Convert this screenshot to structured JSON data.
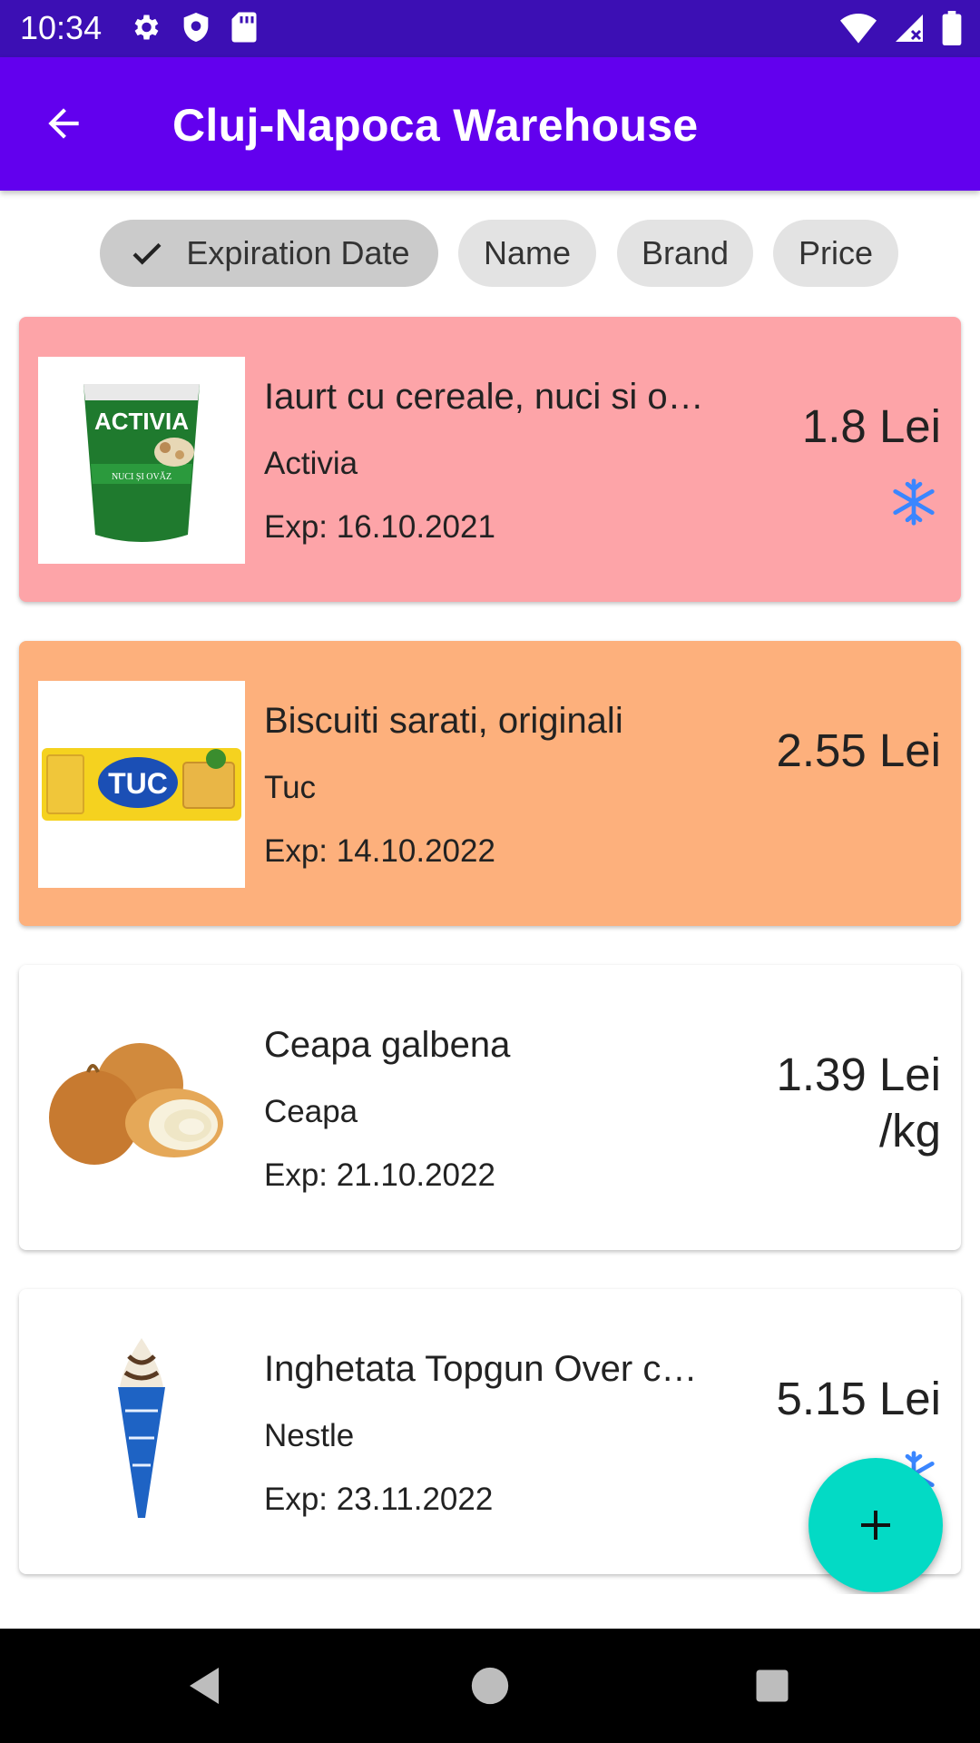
{
  "status_bar": {
    "time": "10:34",
    "left_icons": [
      "gear-icon",
      "shield-icon",
      "sd-card-icon"
    ],
    "right_icons": [
      "wifi-icon",
      "signal-icon",
      "battery-icon"
    ]
  },
  "app_bar": {
    "title": "Cluj-Napoca Warehouse",
    "back_icon": "arrow-back-icon"
  },
  "filters": {
    "chips": [
      {
        "label": "Expiration Date",
        "selected": true
      },
      {
        "label": "Name",
        "selected": false
      },
      {
        "label": "Brand",
        "selected": false
      },
      {
        "label": "Price",
        "selected": false
      }
    ]
  },
  "products": [
    {
      "name": "Iaurt cu cereale, nuci si o…",
      "brand": "Activia",
      "expiration": "Exp: 16.10.2021",
      "price": "1.8 Lei",
      "frozen": true,
      "card_color": "#fda4a8",
      "image": "activia-yogurt"
    },
    {
      "name": "Biscuiti sarati, originali",
      "brand": "Tuc",
      "expiration": "Exp: 14.10.2022",
      "price": "2.55 Lei",
      "frozen": false,
      "card_color": "#fdb07c",
      "image": "tuc-crackers"
    },
    {
      "name": "Ceapa galbena",
      "brand": "Ceapa",
      "expiration": "Exp: 21.10.2022",
      "price": "1.39 Lei",
      "price_unit": "/kg",
      "frozen": false,
      "card_color": "#ffffff",
      "image": "onions"
    },
    {
      "name": "Inghetata Topgun Over c…",
      "brand": "Nestle",
      "expiration": "Exp: 23.11.2022",
      "price": "5.15 Lei",
      "frozen": true,
      "card_color": "#ffffff",
      "image": "ice-cream-cone"
    }
  ],
  "fab": {
    "icon": "plus-icon"
  },
  "navigation_bar": {
    "buttons": [
      "back-triangle-icon",
      "home-circle-icon",
      "recents-square-icon"
    ]
  },
  "colors": {
    "status_bar": "#3c0fb4",
    "app_bar": "#6200ee",
    "fab": "#03dac5",
    "frozen_icon": "#3a86ff"
  }
}
